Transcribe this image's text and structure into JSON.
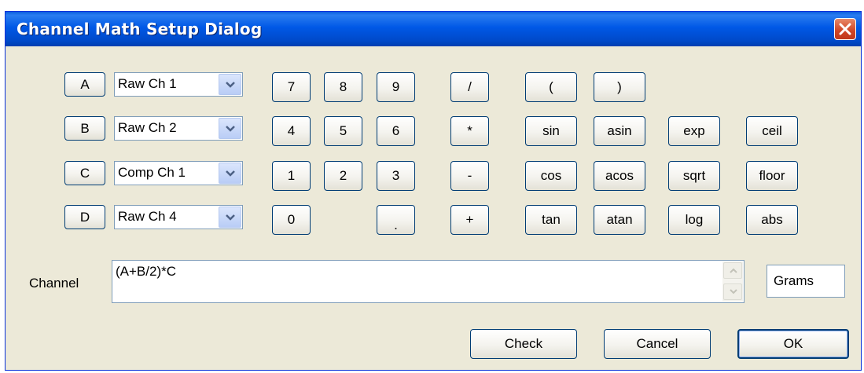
{
  "window": {
    "title": "Channel Math Setup Dialog"
  },
  "channels": [
    {
      "letter": "A",
      "source": "Raw Ch 1"
    },
    {
      "letter": "B",
      "source": "Raw Ch 2"
    },
    {
      "letter": "C",
      "source": "Comp Ch 1"
    },
    {
      "letter": "D",
      "source": "Raw Ch 4"
    }
  ],
  "keypad": {
    "k7": "7",
    "k8": "8",
    "k9": "9",
    "k4": "4",
    "k5": "5",
    "k6": "6",
    "k1": "1",
    "k2": "2",
    "k3": "3",
    "k0": "0",
    "dot": "."
  },
  "operators": {
    "divide": "/",
    "multiply": "*",
    "subtract": "-",
    "add": "+"
  },
  "functions": {
    "open_paren": "(",
    "close_paren": ")",
    "sin": "sin",
    "asin": "asin",
    "exp": "exp",
    "ceil": "ceil",
    "cos": "cos",
    "acos": "acos",
    "sqrt": "sqrt",
    "floor": "floor",
    "tan": "tan",
    "atan": "atan",
    "log": "log",
    "abs": "abs"
  },
  "expression": {
    "label": "Channel",
    "value": "(A+B/2)*C",
    "units": "Grams"
  },
  "actions": {
    "check": "Check",
    "cancel": "Cancel",
    "ok": "OK"
  },
  "colors": {
    "title_bar": "#0058e6",
    "close_button": "#d04424",
    "dialog_face": "#ece9d8",
    "button_border": "#003c74"
  }
}
